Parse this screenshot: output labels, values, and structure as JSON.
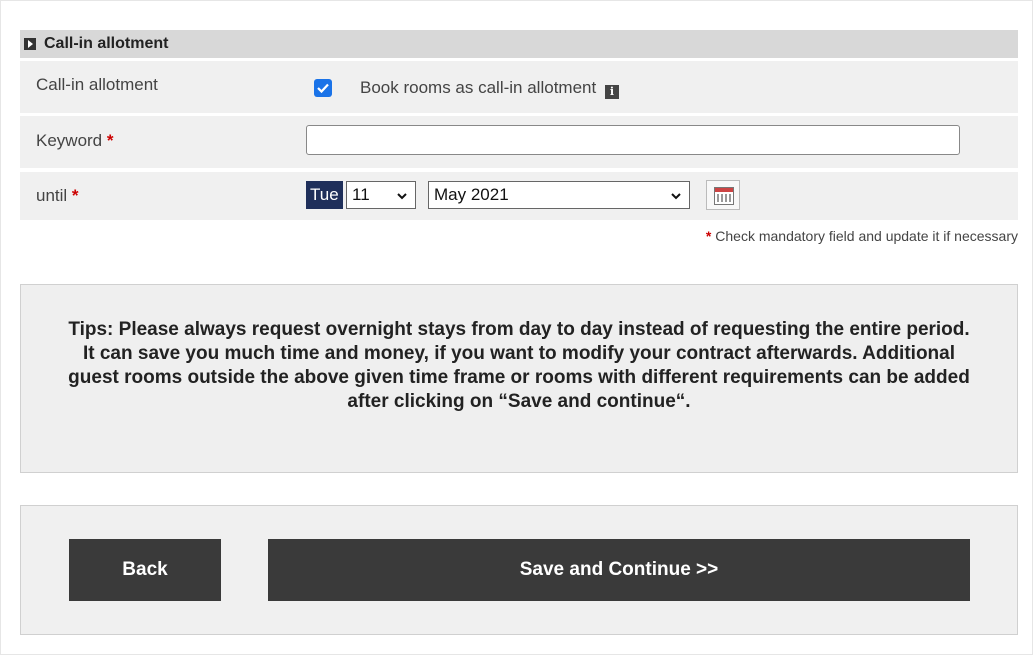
{
  "section": {
    "title": "Call-in allotment"
  },
  "rows": {
    "allotment": {
      "label": "Call-in allotment",
      "checkbox_label": "Book rooms as call-in allotment",
      "checked": true
    },
    "keyword": {
      "label": "Keyword",
      "required_mark": "*",
      "value": ""
    },
    "until": {
      "label": "until",
      "required_mark": "*",
      "day_name": "Tue",
      "day_value": "11",
      "month_value": "May 2021"
    }
  },
  "mandatory_note": {
    "mark": "*",
    "text": "Check mandatory field and update it if necessary"
  },
  "tips": {
    "text": "Tips: Please always request overnight stays from day to day instead of requesting the entire period. It can save you much time and money, if you want to modify your contract afterwards. Additional guest rooms outside the above given time frame or rooms with different requirements can be added after clicking on “Save and continue“."
  },
  "actions": {
    "back_label": "Back",
    "save_label": "Save and Continue >>"
  },
  "icons": {
    "section_toggle": "expand-toggle-icon",
    "info": "info-icon",
    "calendar": "calendar-icon"
  },
  "colors": {
    "checkbox_accent": "#1a73e8",
    "day_badge": "#1f2f5a",
    "button_bg": "#3a3a3a",
    "required": "#cc0000"
  }
}
